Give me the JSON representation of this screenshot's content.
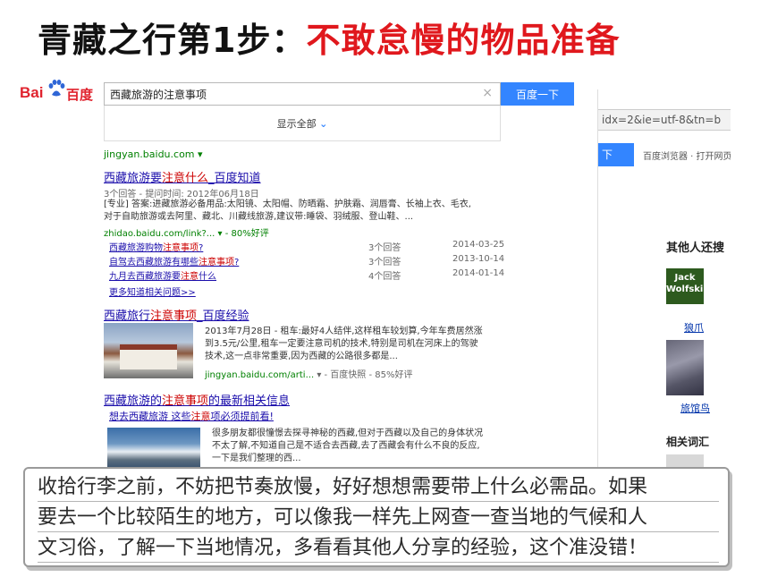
{
  "slide": {
    "title_prefix": "青藏之行第1步：",
    "title_highlight": "不敢怠慢的物品准备"
  },
  "baidu": {
    "logo_bai": "Bai",
    "logo_du": "百度",
    "search_query": "西藏旅游的注意事项",
    "clear_icon": "×",
    "search_button": "百度一下",
    "show_all": "显示全部",
    "show_all_chevron": "⌄",
    "site_line": "jingyan.baidu.com  ▾",
    "results": [
      {
        "title_pre": "西藏旅游要",
        "title_hl": "注意什么",
        "title_post": "_百度知道",
        "meta": "3个回答 - 提问时间: 2012年06月18日",
        "desc_1": "[专业] 答案:进藏旅游必备用品:太阳镜、太阳帽、防晒霜、护肤霜、润唇膏、长袖上衣、毛衣,",
        "desc_2": "对于自助旅游或去阿里、藏北、川藏线旅游,建议带:睡袋、羽绒服、登山鞋、...",
        "green": "zhidao.baidu.com/link?...  ▾  -  80%好评",
        "subrows": [
          {
            "pre": "西藏旅游购物",
            "hl": "注意事项",
            "post": "?",
            "count": "3个回答",
            "date": "2014-03-25"
          },
          {
            "pre": "自驾去西藏旅游有哪些",
            "hl": "注意事项",
            "post": "?",
            "count": "3个回答",
            "date": "2013-10-14"
          },
          {
            "pre": "九月去西藏旅游要",
            "hl": "注意",
            "post": "什么",
            "count": "4个回答",
            "date": "2014-01-14"
          }
        ],
        "more": "更多知道相关问题>>"
      },
      {
        "title_pre": "西藏旅行",
        "title_hl": "注意事项",
        "title_post": "_百度经验",
        "desc_1": "2013年7月28日 - 租车:最好4人结伴,这样租车较划算,今年车费居然涨",
        "desc_2": "到3.5元/公里,租车一定要注意司机的技术,特别是司机在河床上的驾驶",
        "desc_3": "技术,这一点非常重要,因为西藏的公路很多都是...",
        "green_url": "jingyan.baidu.com/arti...",
        "green_rest": "▾  -  百度快照  -  85%好评"
      },
      {
        "title_pre": "西藏旅游的",
        "title_hl": "注意事项",
        "title_post": "的最新相关信息",
        "sub_pre": "想去西藏旅游 这些",
        "sub_hl": "注意",
        "sub_post": "项必须提前看!",
        "desc_1": "很多朋友都很憧憬去探寻神秘的西藏,但对于西藏以及自己的身体状况",
        "desc_2": "不太了解,不知道自己是不适合去西藏,去了西藏会有什么不良的反应,",
        "desc_3": "一下是我们整理的西..."
      }
    ]
  },
  "background_browser": {
    "url_fragment": "idx=2&ie=utf-8&tn=b",
    "button_fragment": "下",
    "note": "百度浏览器 · 打开网页",
    "others_search": "其他人还搜",
    "logo_text": "Jack Wolfskin",
    "link_1": "狼爪",
    "link_2": "旅馆鸟",
    "related": "相关词汇"
  },
  "bubble": {
    "line_1": "收拾行李之前，不妨把节奏放慢，好好想想需要带上什么必需品。如果",
    "line_2": "要去一个比较陌生的地方，可以像我一样先上网查一查当地的气候和人",
    "line_3": "文习俗，了解一下当地情况，多看看其他人分享的经验，这个准没错！"
  },
  "colors": {
    "title_red": "#e0181d",
    "baidu_blue": "#3385ff",
    "link_blue": "#1a0dab",
    "highlight_red": "#c00"
  }
}
